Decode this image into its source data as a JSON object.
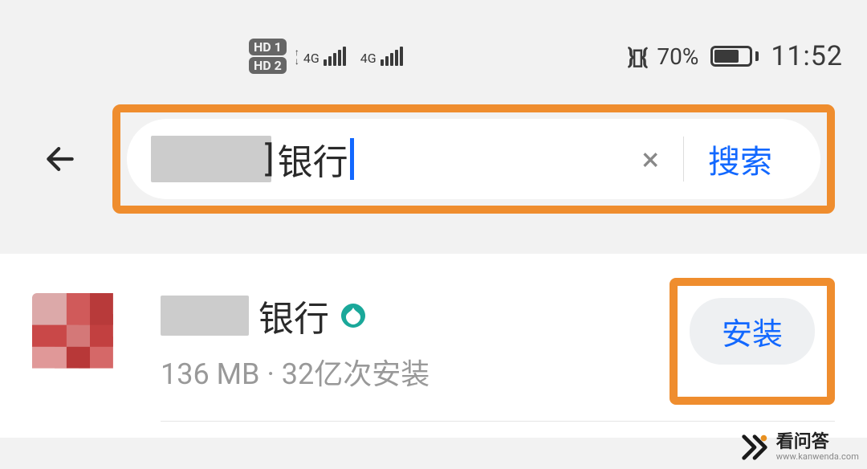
{
  "status_bar": {
    "hd1_label": "HD 1",
    "hd2_label": "HD 2",
    "signal1_label": "4G",
    "signal2_label": "4G",
    "battery_percent": "70%",
    "time": "11:52"
  },
  "search": {
    "partial_char": "]",
    "text": "银行",
    "clear_icon": "×",
    "submit_label": "搜索"
  },
  "result": {
    "app_name_suffix": "银行",
    "size": "136 MB",
    "separator": "·",
    "install_count": "32亿次安装",
    "install_label": "安装"
  },
  "watermark": {
    "title": "看问答",
    "url": "www.kanwenda.com"
  }
}
